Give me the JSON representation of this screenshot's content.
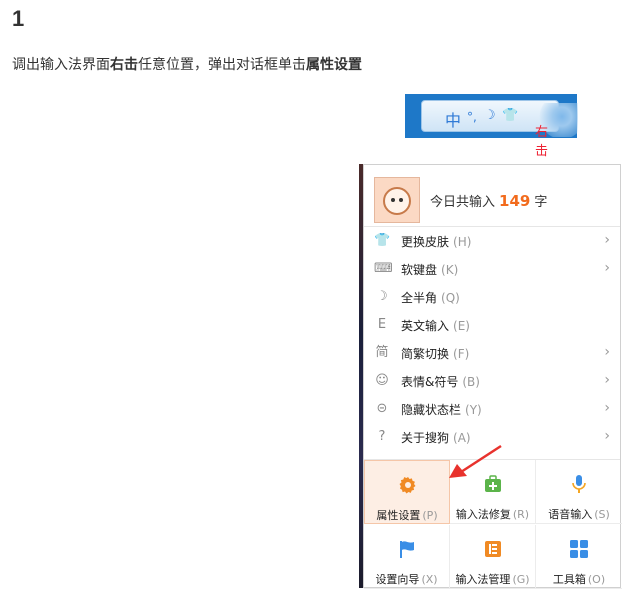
{
  "step": "1",
  "instruction": {
    "p1": "调出输入法界面",
    "b1": "右击",
    "p2": "任意位置，弹出对话框单击",
    "b2": "属性设置"
  },
  "ime_bar": {
    "zhong": "中",
    "dots": "°,",
    "moon": "☽",
    "shirt": "👕",
    "right_click_label": "右击"
  },
  "menu": {
    "header": {
      "prefix": "今日共输入",
      "count": "149",
      "suffix": "字"
    },
    "items": [
      {
        "label": "更换皮肤",
        "key": "(H)",
        "icon": "shirt-icon",
        "glyph": "👕",
        "has_sub": true
      },
      {
        "label": "软键盘",
        "key": "(K)",
        "icon": "keyboard-icon",
        "glyph": "⌨",
        "has_sub": true
      },
      {
        "label": "全半角",
        "key": "(Q)",
        "icon": "moon-icon",
        "glyph": "☽",
        "has_sub": false
      },
      {
        "label": "英文输入",
        "key": "(E)",
        "icon": "english-icon",
        "glyph": "E",
        "has_sub": false
      },
      {
        "label": "简繁切换",
        "key": "(F)",
        "icon": "simplified-icon",
        "glyph": "简",
        "has_sub": true
      },
      {
        "label": "表情&符号",
        "key": "(B)",
        "icon": "emoji-icon",
        "glyph": "☺",
        "has_sub": true
      },
      {
        "label": "隐藏状态栏",
        "key": "(Y)",
        "icon": "statusbar-icon",
        "glyph": "⊝",
        "has_sub": true
      },
      {
        "label": "关于搜狗",
        "key": "(A)",
        "icon": "help-icon",
        "glyph": "?",
        "has_sub": true
      }
    ],
    "grid": [
      {
        "label": "属性设置",
        "key": "(P)",
        "icon": "gear-icon",
        "color": "#f08a24",
        "active": true
      },
      {
        "label": "输入法修复",
        "key": "(R)",
        "icon": "repair-kit-icon",
        "color": "#5bb44a",
        "active": false
      },
      {
        "label": "语音输入",
        "key": "(S)",
        "icon": "microphone-icon",
        "color": "#3a8ee6",
        "active": false
      },
      {
        "label": "设置向导",
        "key": "(X)",
        "icon": "flag-icon",
        "color": "#3a8ee6",
        "active": false
      },
      {
        "label": "输入法管理",
        "key": "(G)",
        "icon": "manage-icon",
        "color": "#f08a24",
        "active": false
      },
      {
        "label": "工具箱",
        "key": "(O)",
        "icon": "toolbox-icon",
        "color": "#3a8ee6",
        "active": false
      }
    ]
  },
  "colors": {
    "accent": "#f26b1d",
    "arrow": "#e8322d"
  }
}
